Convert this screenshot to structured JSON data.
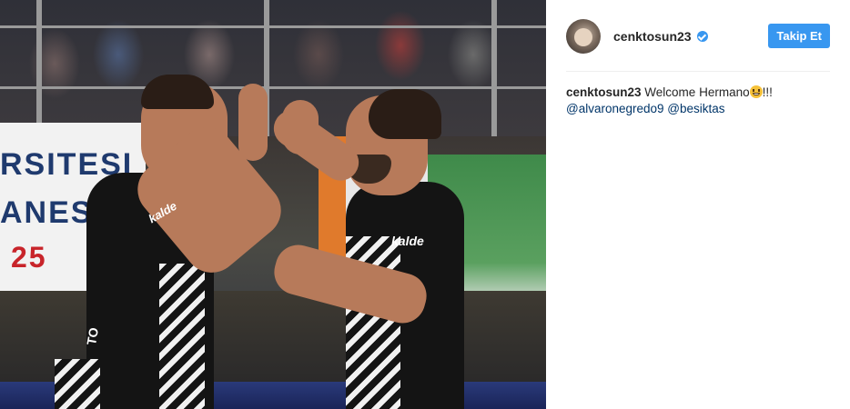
{
  "post": {
    "photo": {
      "banner": {
        "line1": "RSITESI",
        "line2": "ANESI",
        "line3": "25"
      },
      "sponsor_left": "kalde",
      "sponsor_right": "kalde",
      "number_text": "TO"
    },
    "author": {
      "username": "cenktosun23",
      "verified": true
    },
    "follow_label": "Takip Et",
    "caption": {
      "username": "cenktosun23",
      "text": "Welcome Hermano",
      "suffix": "!!!",
      "mentions": [
        "@alvaronegredo9",
        "@besiktas"
      ]
    },
    "colors": {
      "follow_button": "#3897f0",
      "mention": "#003569",
      "verified_badge": "#3897f0"
    },
    "icons": {
      "verified": "verified-badge-icon",
      "emoji": "grinning-face-emoji-icon"
    }
  }
}
